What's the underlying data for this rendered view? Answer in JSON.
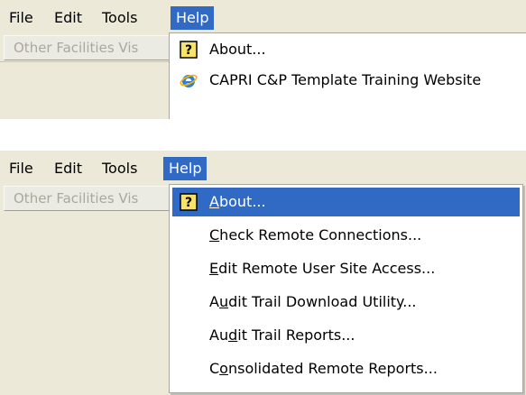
{
  "menubar": {
    "file": "File",
    "edit": "Edit",
    "tools": "Tools",
    "help": "Help"
  },
  "toolbar": {
    "facilities_button": "Other Facilities Vis"
  },
  "help_menu_short": {
    "items": [
      "About...",
      "CAPRI C&P Template Training Website"
    ]
  },
  "help_menu_full": {
    "items": [
      {
        "pre": "",
        "u": "A",
        "post": "bout..."
      },
      {
        "pre": "",
        "u": "C",
        "post": "heck Remote Connections..."
      },
      {
        "pre": "",
        "u": "E",
        "post": "dit Remote User Site Access..."
      },
      {
        "pre": "A",
        "u": "u",
        "post": "dit Trail Download Utility..."
      },
      {
        "pre": "Au",
        "u": "d",
        "post": "it Trail Reports..."
      },
      {
        "pre": "C",
        "u": "o",
        "post": "nsolidated Remote Reports..."
      }
    ]
  },
  "colors": {
    "highlight": "#316ac5",
    "panel": "#ece9d8",
    "disabled_text": "#a9a89c"
  },
  "icons": [
    "help-about-icon",
    "ie-website-icon"
  ]
}
